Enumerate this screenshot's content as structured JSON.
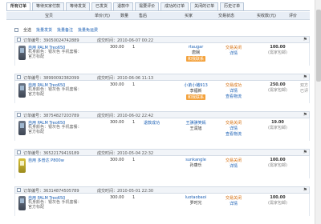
{
  "tabs": [
    "所有订单",
    "等待买家付款",
    "等待发货",
    "已发货",
    "退款中",
    "需要评价",
    "成功的订单",
    "关闭的订单",
    "历史订单"
  ],
  "header": {
    "item": "宝贝",
    "price": "单价(元)",
    "qty": "数量",
    "aftersale": "售后",
    "buyer": "买家",
    "status": "交易状态",
    "paid": "实收款(元)",
    "rate": "评价"
  },
  "actions": {
    "select_all": "全选",
    "batch_ship": "批量发货",
    "batch_note": "批量备注",
    "batch_free": "批量免运费"
  },
  "orders": [
    {
      "no": "订单编号：39050024742889",
      "time": "成交时间：2010-06-07 00:22",
      "name": "自用 PALM Treo650",
      "desc": "机身颜色：银灰色    手机套餐：官方标配",
      "price": "300.00",
      "qty": "1",
      "aftersale": "",
      "buyer": "rtaugar",
      "seller": "唐娴",
      "wang": "和我联系",
      "status": "交易关闭",
      "detail": "详情",
      "logistics": "",
      "paid": "100.00",
      "paid_note": "(需家包邮)",
      "rate": ""
    },
    {
      "no": "订单编号：38990092382099",
      "time": "成交时间：2010-06-06 11:13",
      "name": "自用 PALM Treo650",
      "desc": "机身颜色：银灰色    手机套餐：官方标配",
      "price": "300.00",
      "qty": "1",
      "aftersale": "",
      "buyer": "小弟小猪913",
      "seller": "李福新",
      "wang": "和我联系",
      "status": "交易成功",
      "detail": "详情",
      "logistics": "查看物流",
      "paid": "250.00",
      "paid_note": "(需家包邮)",
      "rate": "双方已评"
    },
    {
      "no": "订单编号：38754827203789",
      "time": "成交时间：2010-06-02 22:42",
      "name": "自用 PALM Treo650",
      "desc": "机身颜色：银灰色    手机套餐：官方标配",
      "price": "300.00",
      "qty": "1",
      "aftersale": "退款成功",
      "buyer": "王骐骐笑嫣",
      "seller": "王润旭",
      "wang": "",
      "status": "交易关闭",
      "detail": "详情",
      "logistics": "查看物流",
      "paid": "19.00",
      "paid_note": "(需家包邮)",
      "rate": ""
    },
    {
      "no": "订单编号：36522179419189",
      "time": "成交时间：2010-05-04 22:32",
      "name": "自用 多普达 P800w",
      "desc": "",
      "price": "300.00",
      "qty": "1",
      "aftersale": "",
      "buyer": "sunkangle",
      "seller": "孙康乐",
      "wang": "",
      "status": "交易关闭",
      "detail": "详情",
      "logistics": "",
      "paid": "100.00",
      "paid_note": "(需家包邮)",
      "rate": ""
    },
    {
      "no": "订单编号：36314874505789",
      "time": "成交时间：2010-05-01 22:30",
      "name": "自用 PALM Treo650",
      "desc": "机身颜色：银灰色    手机套餐：官方标配",
      "price": "300.00",
      "qty": "1",
      "aftersale": "",
      "buyer": "luotaobaoi",
      "seller": "罗时光",
      "wang": "",
      "status": "交易关闭",
      "detail": "详情",
      "logistics": "",
      "paid": "100.00",
      "paid_note": "(需家包邮)",
      "rate": ""
    }
  ]
}
